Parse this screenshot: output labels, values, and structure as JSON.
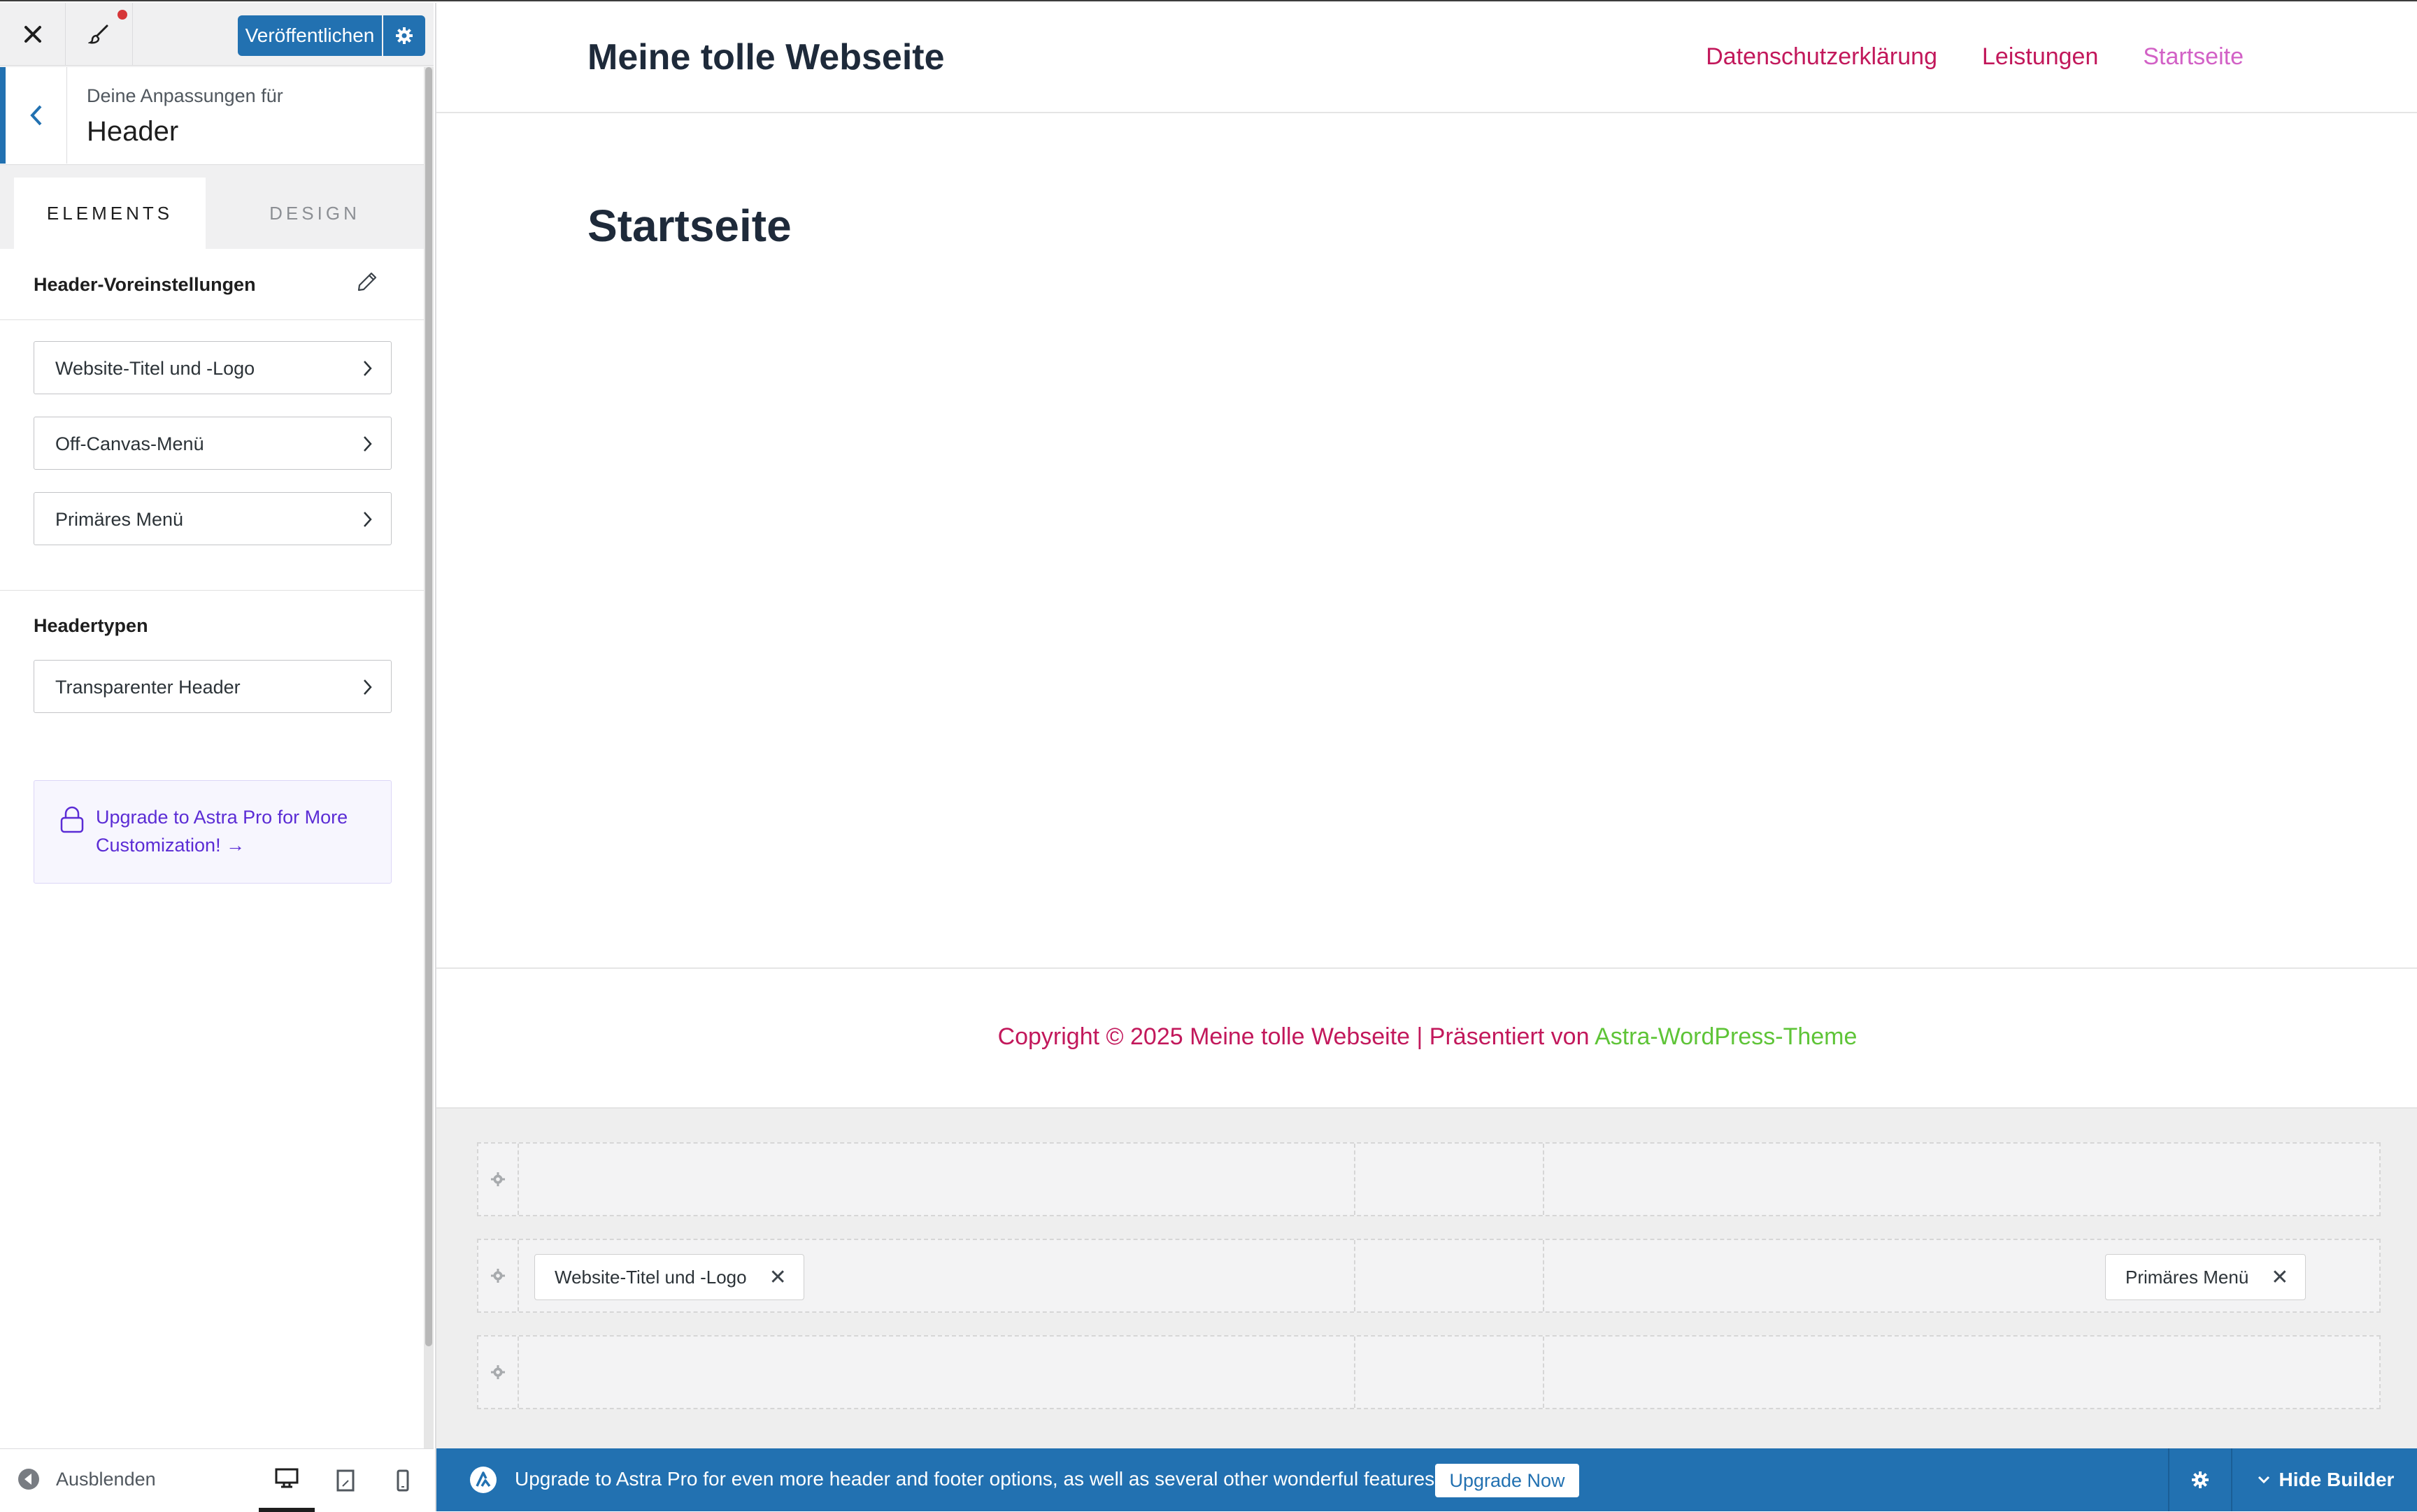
{
  "sidebar": {
    "publish_label": "Veröffentlichen",
    "section_subtitle": "Deine Anpassungen für",
    "section_title": "Header",
    "tabs": [
      {
        "label": "ELEMENTS",
        "active": true
      },
      {
        "label": "DESIGN",
        "active": false
      }
    ],
    "presets_label": "Header-Voreinstellungen",
    "items": [
      {
        "label": "Website-Titel und -Logo"
      },
      {
        "label": "Off-Canvas-Menü"
      },
      {
        "label": "Primäres Menü"
      }
    ],
    "header_types_label": "Headertypen",
    "header_types_items": [
      {
        "label": "Transparenter Header"
      }
    ],
    "upgrade_text": "Upgrade to Astra Pro for More Customization! →",
    "hide_label": "Ausblenden",
    "device": "desktop"
  },
  "preview": {
    "site_title": "Meine tolle Webseite",
    "nav": [
      {
        "label": "Datenschutzerklärung"
      },
      {
        "label": "Leistungen"
      },
      {
        "label": "Startseite",
        "active": true
      }
    ],
    "page_title": "Startseite",
    "footer": {
      "copyright": "Copyright © 2025 Meine tolle Webseite | Präsentiert von ",
      "theme_link": "Astra-WordPress-Theme"
    },
    "builder": {
      "chips": [
        {
          "label": "Website-Titel und -Logo"
        },
        {
          "label": "Primäres Menü"
        }
      ]
    },
    "promo": {
      "message": "Upgrade to Astra Pro for even more header and footer options, as well as several other wonderful features!",
      "cta_label": "Upgrade Now",
      "hide_builder_label": "Hide Builder"
    }
  },
  "colors": {
    "accent": "#2271b1",
    "link": "#c2185b",
    "link_active": "#d261c6",
    "footer_theme_link": "#5ec437",
    "upgrade_text": "#5b2cd5"
  }
}
